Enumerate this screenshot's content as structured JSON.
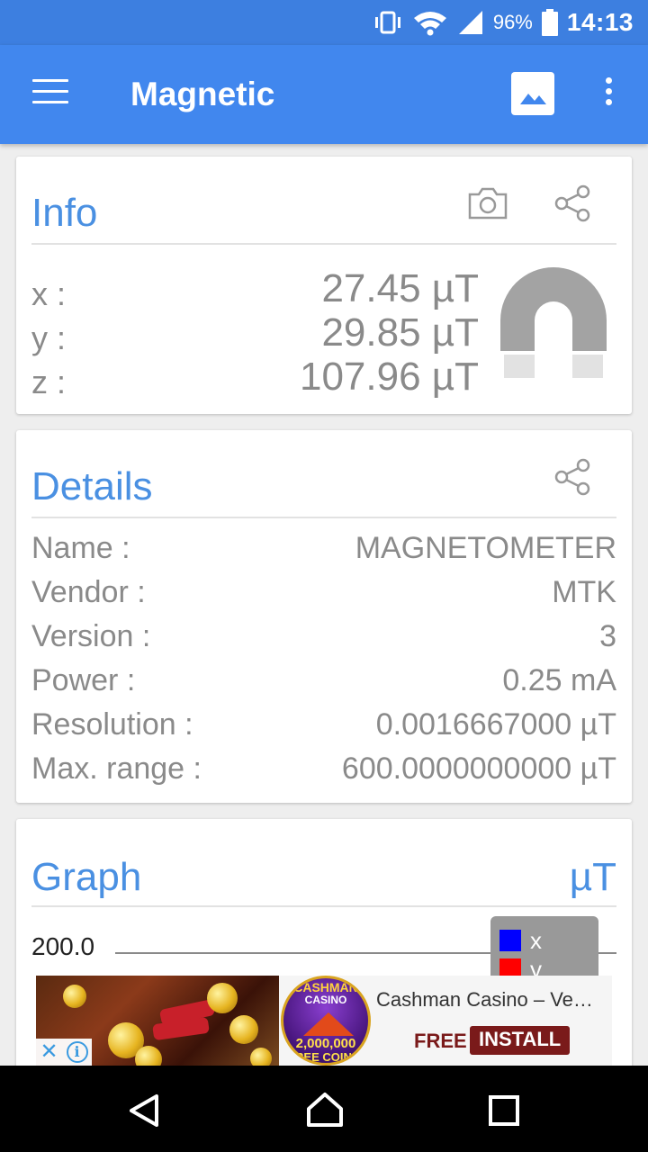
{
  "status_bar": {
    "battery_percent": "96%",
    "time": "14:13",
    "icons": [
      "vibrate-icon",
      "wifi-icon",
      "signal-icon",
      "battery-icon"
    ]
  },
  "app_bar": {
    "title": "Magnetic",
    "icons": [
      "menu-icon",
      "image-icon",
      "more-vert-icon"
    ]
  },
  "info": {
    "title": "Info",
    "axes": [
      {
        "label": "x :",
        "value": "27.45 µT"
      },
      {
        "label": "y :",
        "value": "29.85 µT"
      },
      {
        "label": "z :",
        "value": "107.96 µT"
      }
    ],
    "icons": [
      "camera-icon",
      "share-icon",
      "magnet-icon"
    ]
  },
  "details": {
    "title": "Details",
    "rows": [
      {
        "label": "Name :",
        "value": "MAGNETOMETER"
      },
      {
        "label": "Vendor :",
        "value": "MTK"
      },
      {
        "label": "Version :",
        "value": "3"
      },
      {
        "label": "Power :",
        "value": "0.25 mA"
      },
      {
        "label": "Resolution :",
        "value": "0.0016667000 µT"
      },
      {
        "label": "Max. range :",
        "value": "600.0000000000 µT"
      }
    ]
  },
  "graph": {
    "title": "Graph",
    "unit": "µT",
    "y_tick": "200.0",
    "legend": [
      {
        "label": "x",
        "color": "#0000ff"
      },
      {
        "label": "y",
        "color": "#ff0000"
      }
    ]
  },
  "ad": {
    "title": "Cashman Casino – Ve…",
    "free_label": "FREE",
    "install_label": "INSTALL",
    "logo_line1": "CASHMAN",
    "logo_line2": "CASINO",
    "logo_line3": "2,000,000",
    "logo_line4": "FREE COINS!"
  },
  "colors": {
    "primary": "#4187ee",
    "accent_text": "#4a90e2",
    "secondary_text": "#8a8a8a"
  }
}
